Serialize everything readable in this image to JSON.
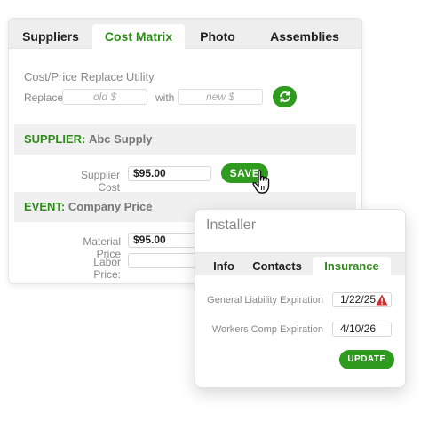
{
  "main": {
    "tabs": [
      {
        "label": "Suppliers"
      },
      {
        "label": "Cost Matrix"
      },
      {
        "label": "Photo"
      },
      {
        "label": "Assemblies"
      }
    ],
    "active_tab": "Cost Matrix",
    "utility": {
      "title": "Cost/Price Replace Utility",
      "replace_label": "Replace",
      "old_placeholder": "old $",
      "with_label": "with",
      "new_placeholder": "new $",
      "refresh_icon": "refresh-icon"
    },
    "supplier": {
      "key": "SUPPLIER:",
      "name": "Abc Supply",
      "cost_label": "Supplier Cost",
      "cost_value": "$95.00",
      "save_label": "SAVE",
      "cursor_icon": "hand-pointer-icon"
    },
    "event": {
      "key": "EVENT:",
      "name": "Company Price",
      "material_label": "Material  Price",
      "material_value": "$95.00",
      "labor_label": "Labor Price:",
      "labor_value": ""
    }
  },
  "installer": {
    "title": "Installer",
    "tabs": [
      {
        "label": "Info"
      },
      {
        "label": "Contacts"
      },
      {
        "label": "Insurance"
      }
    ],
    "active_tab": "Insurance",
    "general_liability_label": "General Liability Expiration",
    "general_liability_date": "1/22/25",
    "warning_icon": "warning-triangle-icon",
    "workers_comp_label": "Workers Comp Expiration",
    "workers_comp_date": "4/10/26",
    "update_label": "UPDATE"
  },
  "colors": {
    "accent_green": "#2e9a1e",
    "warning_red": "#d32f2f"
  }
}
